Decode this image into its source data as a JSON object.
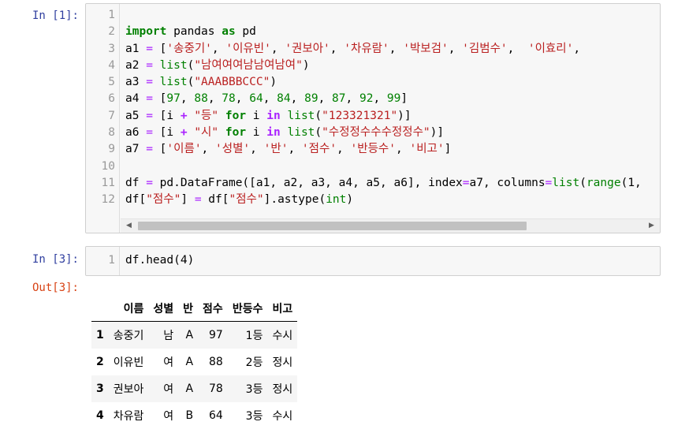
{
  "cells": [
    {
      "prompt": "In [1]:",
      "lines": [
        {
          "num": "1",
          "tokens": []
        },
        {
          "num": "2",
          "tokens": [
            [
              "kw",
              "import"
            ],
            [
              "p",
              " pandas "
            ],
            [
              "kw",
              "as"
            ],
            [
              "p",
              " pd"
            ]
          ]
        },
        {
          "num": "3",
          "tokens": [
            [
              "p",
              "a1 "
            ],
            [
              "eq",
              "="
            ],
            [
              "p",
              " ["
            ],
            [
              "str",
              "'송중기'"
            ],
            [
              "p",
              ", "
            ],
            [
              "str",
              "'이유빈'"
            ],
            [
              "p",
              ", "
            ],
            [
              "str",
              "'권보아'"
            ],
            [
              "p",
              ", "
            ],
            [
              "str",
              "'차유람'"
            ],
            [
              "p",
              ", "
            ],
            [
              "str",
              "'박보검'"
            ],
            [
              "p",
              ", "
            ],
            [
              "str",
              "'김범수'"
            ],
            [
              "p",
              ",  "
            ],
            [
              "str",
              "'이효리'"
            ],
            [
              "p",
              ","
            ]
          ]
        },
        {
          "num": "4",
          "tokens": [
            [
              "p",
              "a2 "
            ],
            [
              "eq",
              "="
            ],
            [
              "p",
              " "
            ],
            [
              "bi",
              "list"
            ],
            [
              "p",
              "("
            ],
            [
              "str",
              "\"남여여여남남여남여\""
            ],
            [
              "p",
              ")"
            ]
          ]
        },
        {
          "num": "5",
          "tokens": [
            [
              "p",
              "a3 "
            ],
            [
              "eq",
              "="
            ],
            [
              "p",
              " "
            ],
            [
              "bi",
              "list"
            ],
            [
              "p",
              "("
            ],
            [
              "str",
              "\"AAABBBCCC\""
            ],
            [
              "p",
              ")"
            ]
          ]
        },
        {
          "num": "6",
          "tokens": [
            [
              "p",
              "a4 "
            ],
            [
              "eq",
              "="
            ],
            [
              "p",
              " ["
            ],
            [
              "num",
              "97"
            ],
            [
              "p",
              ", "
            ],
            [
              "num",
              "88"
            ],
            [
              "p",
              ", "
            ],
            [
              "num",
              "78"
            ],
            [
              "p",
              ", "
            ],
            [
              "num",
              "64"
            ],
            [
              "p",
              ", "
            ],
            [
              "num",
              "84"
            ],
            [
              "p",
              ", "
            ],
            [
              "num",
              "89"
            ],
            [
              "p",
              ", "
            ],
            [
              "num",
              "87"
            ],
            [
              "p",
              ", "
            ],
            [
              "num",
              "92"
            ],
            [
              "p",
              ", "
            ],
            [
              "num",
              "99"
            ],
            [
              "p",
              "]"
            ]
          ]
        },
        {
          "num": "7",
          "tokens": [
            [
              "p",
              "a5 "
            ],
            [
              "eq",
              "="
            ],
            [
              "p",
              " [i "
            ],
            [
              "op",
              "+"
            ],
            [
              "p",
              " "
            ],
            [
              "str",
              "\"등\""
            ],
            [
              "p",
              " "
            ],
            [
              "kw",
              "for"
            ],
            [
              "p",
              " i "
            ],
            [
              "op",
              "in"
            ],
            [
              "p",
              " "
            ],
            [
              "bi",
              "list"
            ],
            [
              "p",
              "("
            ],
            [
              "str",
              "\"123321321\""
            ],
            [
              "p",
              ")]"
            ]
          ]
        },
        {
          "num": "8",
          "tokens": [
            [
              "p",
              "a6 "
            ],
            [
              "eq",
              "="
            ],
            [
              "p",
              " [i "
            ],
            [
              "op",
              "+"
            ],
            [
              "p",
              " "
            ],
            [
              "str",
              "\"시\""
            ],
            [
              "p",
              " "
            ],
            [
              "kw",
              "for"
            ],
            [
              "p",
              " i "
            ],
            [
              "op",
              "in"
            ],
            [
              "p",
              " "
            ],
            [
              "bi",
              "list"
            ],
            [
              "p",
              "("
            ],
            [
              "str",
              "\"수정정수수수정정수\""
            ],
            [
              "p",
              ")]"
            ]
          ]
        },
        {
          "num": "9",
          "tokens": [
            [
              "p",
              "a7 "
            ],
            [
              "eq",
              "="
            ],
            [
              "p",
              " ["
            ],
            [
              "str",
              "'이름'"
            ],
            [
              "p",
              ", "
            ],
            [
              "str",
              "'성별'"
            ],
            [
              "p",
              ", "
            ],
            [
              "str",
              "'반'"
            ],
            [
              "p",
              ", "
            ],
            [
              "str",
              "'점수'"
            ],
            [
              "p",
              ", "
            ],
            [
              "str",
              "'반등수'"
            ],
            [
              "p",
              ", "
            ],
            [
              "str",
              "'비고'"
            ],
            [
              "p",
              "]"
            ]
          ]
        },
        {
          "num": "10",
          "tokens": []
        },
        {
          "num": "11",
          "tokens": [
            [
              "p",
              "df "
            ],
            [
              "eq",
              "="
            ],
            [
              "p",
              " pd.DataFrame([a1, a2, a3, a4, a5, a6], index"
            ],
            [
              "eq",
              "="
            ],
            [
              "p",
              "a7, columns"
            ],
            [
              "eq",
              "="
            ],
            [
              "bi",
              "list"
            ],
            [
              "p",
              "("
            ],
            [
              "bi",
              "range"
            ],
            [
              "p",
              "(1,"
            ]
          ]
        },
        {
          "num": "12",
          "tokens": [
            [
              "p",
              "df["
            ],
            [
              "str",
              "\"점수\""
            ],
            [
              "p",
              "] "
            ],
            [
              "eq",
              "="
            ],
            [
              "p",
              " df["
            ],
            [
              "str",
              "\"점수\""
            ],
            [
              "p",
              "].astype("
            ],
            [
              "bi",
              "int"
            ],
            [
              "p",
              ")"
            ]
          ]
        }
      ]
    },
    {
      "prompt": "In [3]:",
      "lines": [
        {
          "num": "1",
          "tokens": [
            [
              "p",
              "df.head(4)"
            ]
          ]
        }
      ]
    }
  ],
  "output": {
    "prompt": "Out[3]:",
    "columns": [
      "",
      "이름",
      "성별",
      "반",
      "점수",
      "반등수",
      "비고"
    ],
    "rows": [
      [
        "1",
        "송중기",
        "남",
        "A",
        "97",
        "1등",
        "수시"
      ],
      [
        "2",
        "이유빈",
        "여",
        "A",
        "88",
        "2등",
        "정시"
      ],
      [
        "3",
        "권보아",
        "여",
        "A",
        "78",
        "3등",
        "정시"
      ],
      [
        "4",
        "차유람",
        "여",
        "B",
        "64",
        "3등",
        "수시"
      ]
    ]
  },
  "scrollbar": {
    "left_arrow": "◀",
    "right_arrow": "▶"
  },
  "colors": {
    "keyword": "#008000",
    "string": "#ba2121",
    "operator": "#aa22ff",
    "in_prompt": "#303f9f",
    "out_prompt": "#d84315"
  }
}
